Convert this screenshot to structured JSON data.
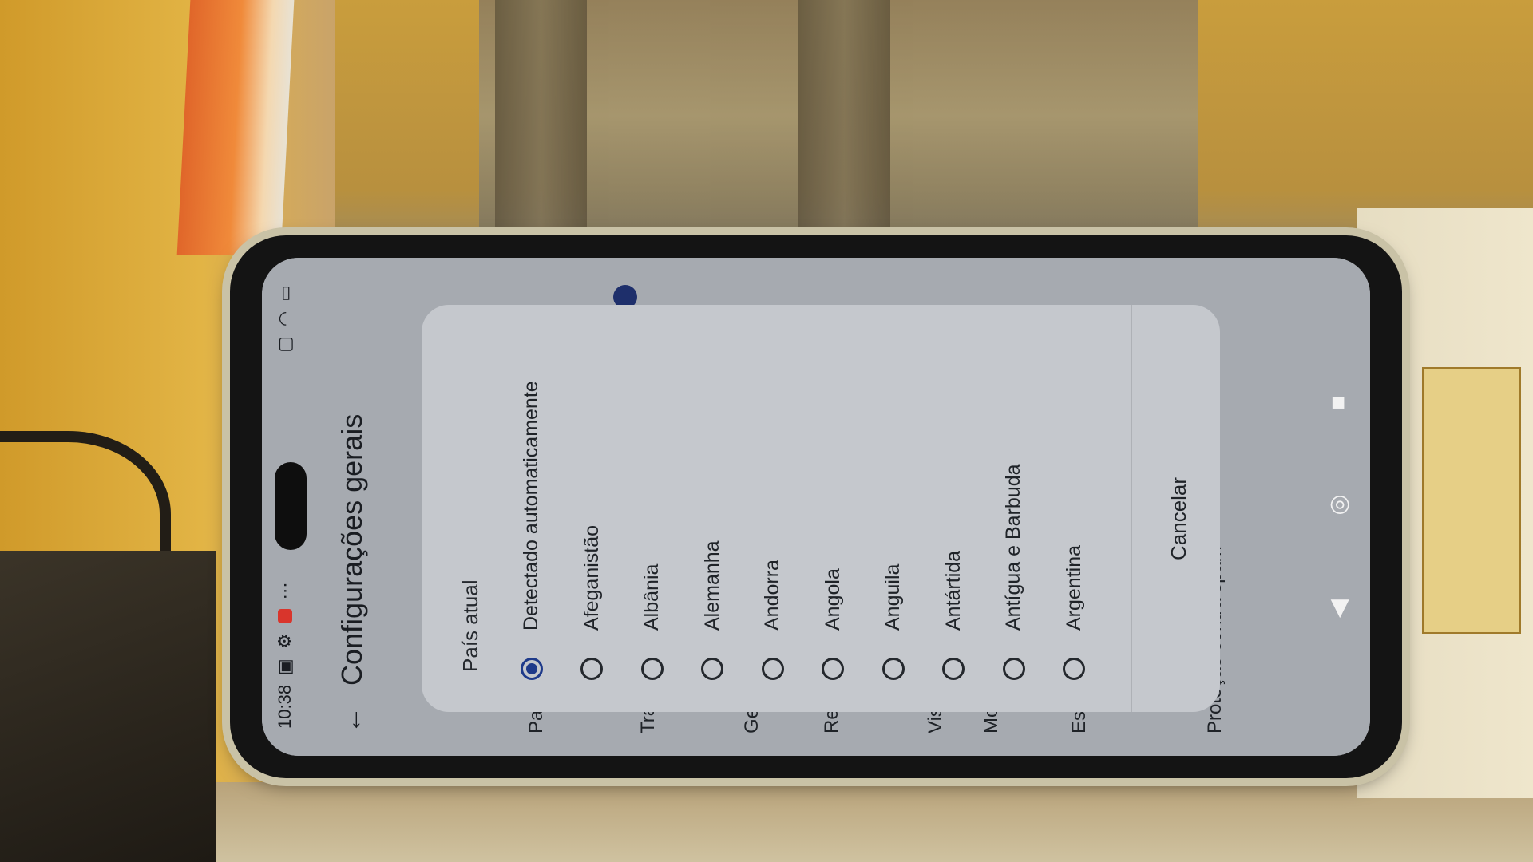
{
  "status_bar": {
    "time": "10:38"
  },
  "header": {
    "title": "Configurações gerais"
  },
  "background_items": [
    "Pa",
    "Tra",
    "Ge",
    "Re",
    "Vis",
    "Mo",
    "Es"
  ],
  "background_last_item": "Proteção contra spam",
  "dialog": {
    "title": "País atual",
    "options": [
      {
        "label": "Detectado automaticamente",
        "checked": true
      },
      {
        "label": "Afeganistão",
        "checked": false
      },
      {
        "label": "Albânia",
        "checked": false
      },
      {
        "label": "Alemanha",
        "checked": false
      },
      {
        "label": "Andorra",
        "checked": false
      },
      {
        "label": "Angola",
        "checked": false
      },
      {
        "label": "Anguila",
        "checked": false
      },
      {
        "label": "Antártida",
        "checked": false
      },
      {
        "label": "Antígua e Barbuda",
        "checked": false
      },
      {
        "label": "Argentina",
        "checked": false
      }
    ],
    "cancel_label": "Cancelar"
  },
  "nav": {
    "back_icon": "triangle-back-icon",
    "home_icon": "circle-home-icon",
    "recents_icon": "square-recents-icon"
  },
  "colors": {
    "accent": "#1e3a8a",
    "dialog_bg": "#c5c8cd",
    "screen_bg": "#a6aab0"
  }
}
